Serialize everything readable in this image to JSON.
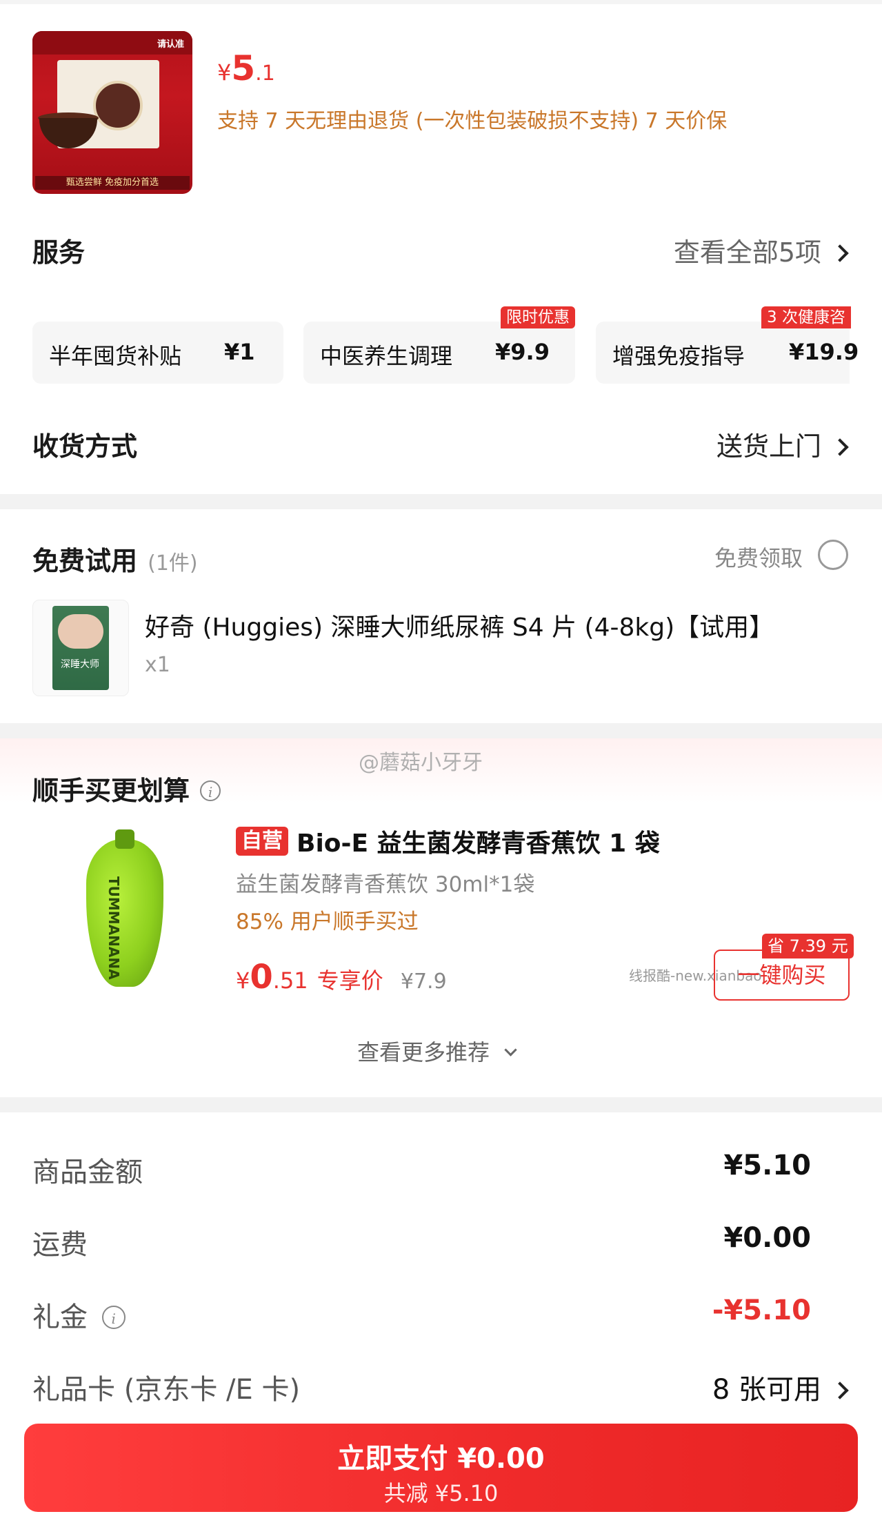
{
  "product": {
    "image_header": "请认准",
    "image_footer": "甄选尝鲜 免疫加分首选",
    "price_symbol": "¥",
    "price_int": "5",
    "price_dec": ".1",
    "policy": "支持 7 天无理由退货 (一次性包装破损不支持)  7 天价保"
  },
  "services": {
    "title": "服务",
    "view_all": "查看全部5项",
    "items": [
      {
        "name": "半年囤货补贴",
        "price": "¥1",
        "badge": ""
      },
      {
        "name": "中医养生调理",
        "price": "¥9.9",
        "badge": "限时优惠"
      },
      {
        "name": "增强免疫指导",
        "price": "¥19.9",
        "badge": "3 次健康咨"
      }
    ]
  },
  "delivery": {
    "title": "收货方式",
    "value": "送货上门"
  },
  "free_trial": {
    "title": "免费试用",
    "count": "(1件)",
    "claim": "免费领取",
    "item_name": "好奇 (Huggies) 深睡大师纸尿裤 S4 片 (4-8kg)【试用】",
    "item_qty": "x1",
    "pack_text": "深睡大师"
  },
  "watermark": "@蘑菇小牙牙",
  "addon": {
    "title": "顺手买更划算",
    "tag": "自营",
    "name": "Bio-E 益生菌发酵青香蕉饮 1 袋",
    "spec": "益生菌发酵青香蕉饮 30ml*1袋",
    "bought": "85% 用户顺手买过",
    "price_symbol": "¥",
    "price_int": "0",
    "price_dec": ".51",
    "price_label": "专享价",
    "original_price": "¥7.9",
    "save_badge": "省 7.39 元",
    "buy_button": "一键购买",
    "bottle_text": "TUMMANANA",
    "source_watermark": "线报酷-new.xianbao",
    "more": "查看更多推荐"
  },
  "summary": {
    "rows": [
      {
        "label": "商品金额",
        "value": "¥5.10"
      },
      {
        "label": "运费",
        "value": "¥0.00"
      },
      {
        "label": "礼金",
        "value": "-¥5.10"
      },
      {
        "label": "礼品卡 (京东卡 /E 卡)",
        "value": "8 张可用"
      }
    ]
  },
  "pay": {
    "label": "立即支付 ¥0.00",
    "sub": "共减 ¥5.10"
  },
  "colors": {
    "accent": "#e8322f",
    "orange_text": "#c9772a",
    "gray_text": "#888888"
  }
}
